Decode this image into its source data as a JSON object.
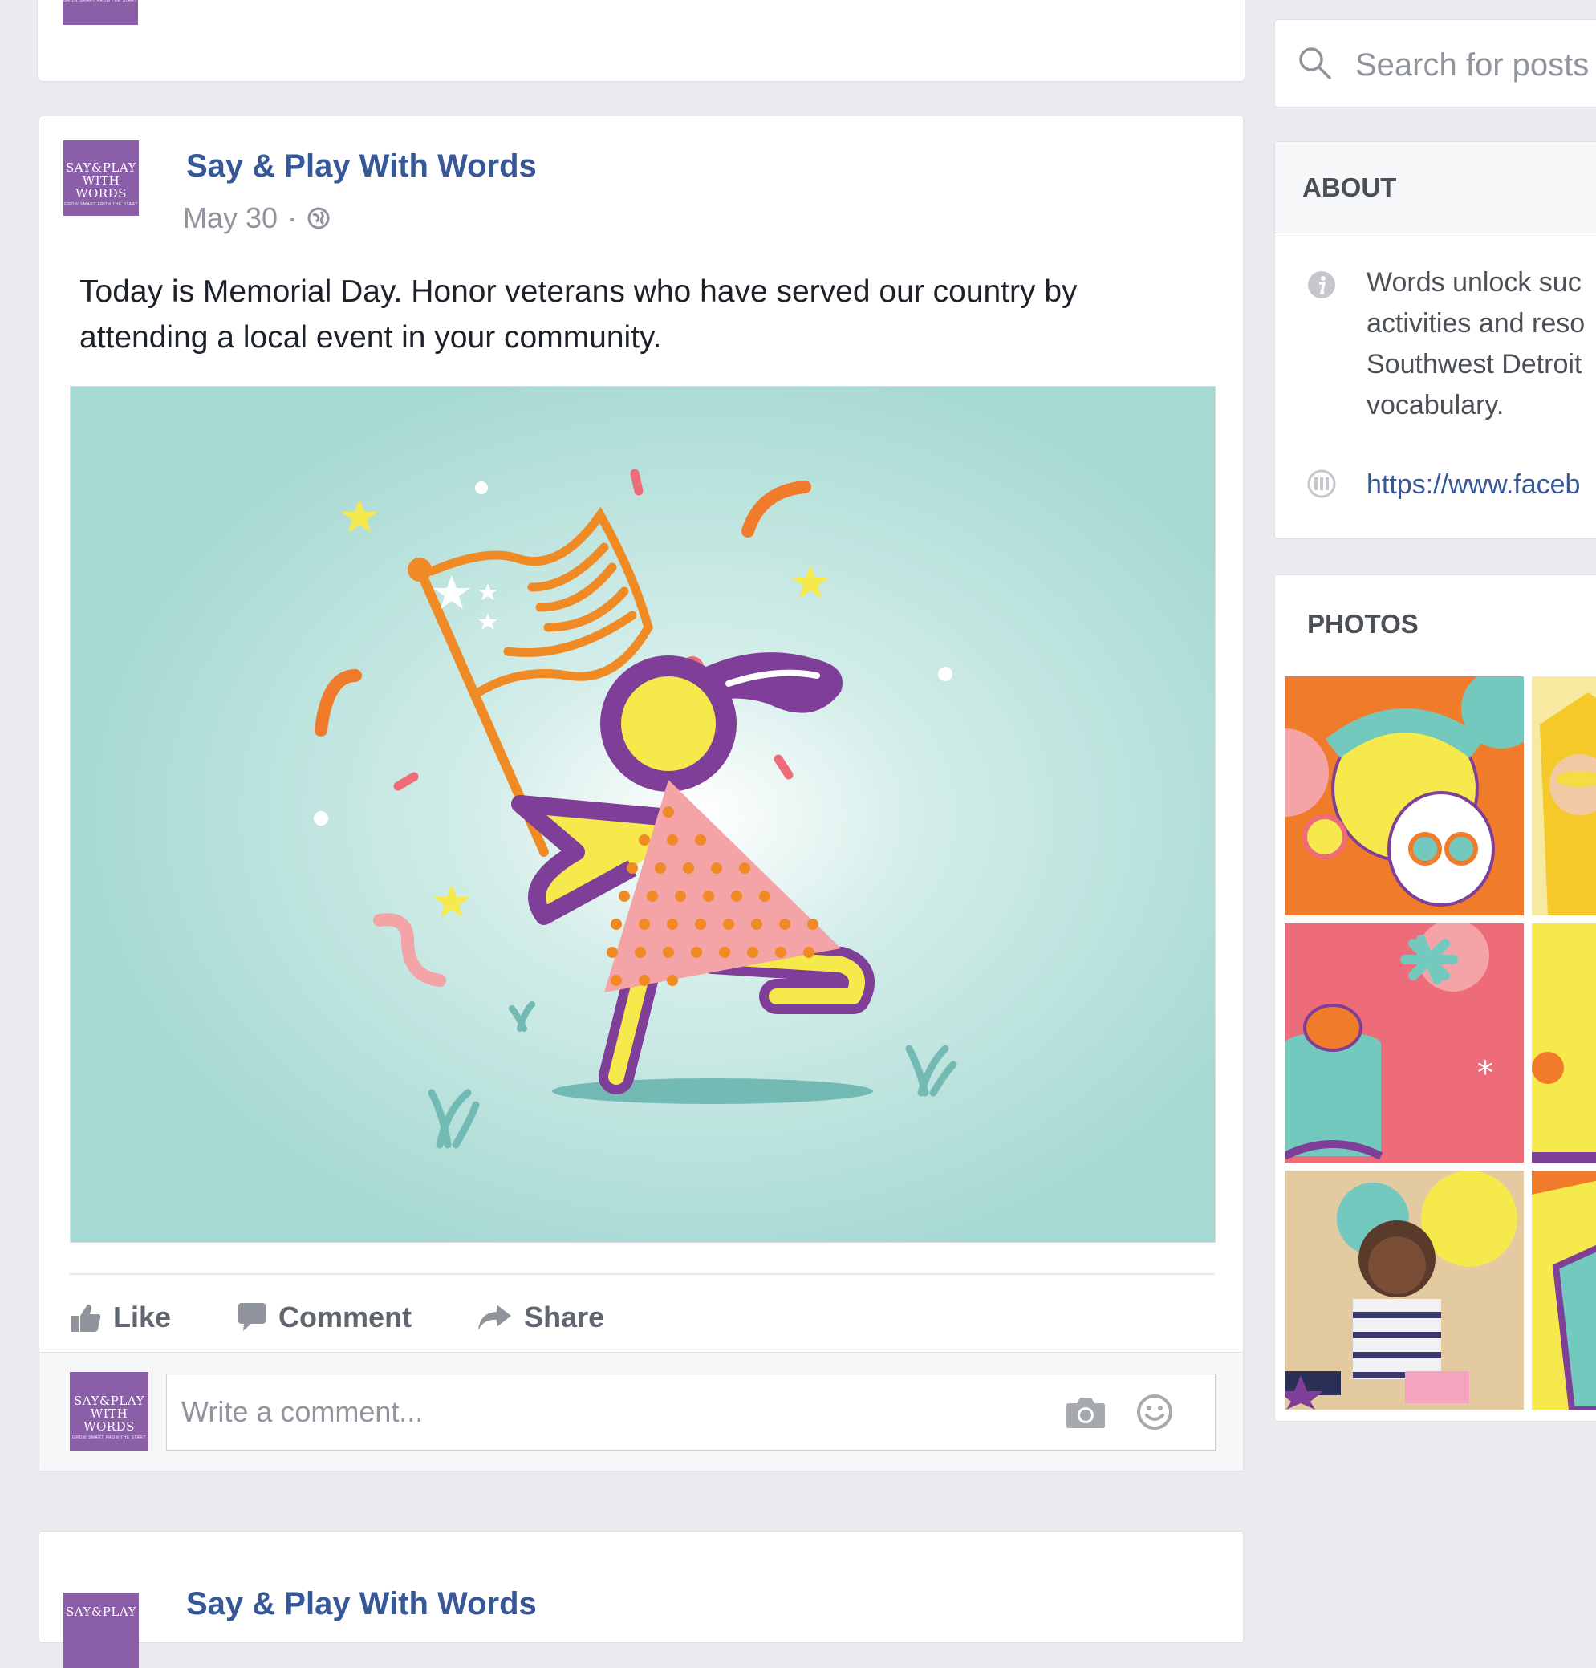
{
  "post": {
    "page_name": "Say & Play With Words",
    "date": "May 30",
    "separator": "·",
    "text_line1": "Today is Memorial Day. Honor veterans who have served our country by",
    "text_line2": "attending a local event in your community.",
    "image_icon": "girl-with-flag-illustration",
    "actions": {
      "like": "Like",
      "comment": "Comment",
      "share": "Share"
    },
    "comment_placeholder": "Write a comment..."
  },
  "logo": {
    "line1": "SAY&PLAY",
    "line2": "WITH WORDS",
    "tagline": "GROW SMART FROM THE START"
  },
  "next_post": {
    "page_name": "Say & Play With Words"
  },
  "sidebar": {
    "search_placeholder": "Search for posts",
    "about": {
      "title": "ABOUT",
      "lines": [
        "Words unlock suc",
        "activities and reso",
        "Southwest Detroit",
        "vocabulary."
      ],
      "link": "https://www.faceb"
    },
    "photos": {
      "title": "PHOTOS"
    }
  },
  "colors": {
    "brand_link": "#365899",
    "logo_purple": "#8b5fa8",
    "image_bg": "#a6d9d2",
    "page_bg": "#e9ebee"
  }
}
